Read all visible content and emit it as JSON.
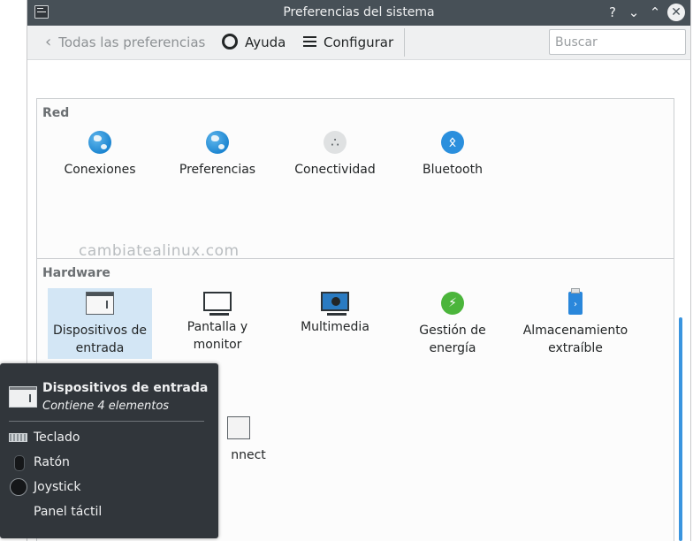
{
  "window": {
    "title": "Preferencias del sistema",
    "titlebar_buttons": {
      "help": "?",
      "minimize": "⌄",
      "maximize": "⌃",
      "close": "✕"
    }
  },
  "toolbar": {
    "back_chevron": "‹",
    "back_label": "Todas las preferencias",
    "help_label": "Ayuda",
    "configure_label": "Configurar",
    "search_placeholder": "Buscar"
  },
  "groups": {
    "red": {
      "title": "Red",
      "items": [
        {
          "label": "Conexiones",
          "icon": "globe-icon"
        },
        {
          "label": "Preferencias",
          "icon": "globe-icon"
        },
        {
          "label": "Conectividad",
          "icon": "share-icon"
        },
        {
          "label": "Bluetooth",
          "icon": "bluetooth-icon"
        }
      ]
    },
    "hardware": {
      "title": "Hardware",
      "items": [
        {
          "label": "Dispositivos de entrada",
          "icon": "input-devices-icon",
          "selected": true
        },
        {
          "label": "Pantalla y monitor",
          "icon": "monitor-icon"
        },
        {
          "label": "Multimedia",
          "icon": "multimedia-icon"
        },
        {
          "label": "Gestión de energía",
          "icon": "energy-icon"
        },
        {
          "label": "Almacenamiento extraíble",
          "icon": "usb-storage-icon"
        },
        {
          "label": "nnect",
          "icon": "kdeconnect-icon",
          "partially_hidden": true
        }
      ]
    }
  },
  "watermark": "cambiatealinux.com",
  "popup": {
    "title": "Dispositivos de entrada",
    "subtitle": "Contiene 4 elementos",
    "items": [
      {
        "label": "Teclado",
        "icon": "keyboard-icon"
      },
      {
        "label": "Ratón",
        "icon": "mouse-icon"
      },
      {
        "label": "Joystick",
        "icon": "joystick-icon"
      },
      {
        "label": "Panel táctil",
        "icon": ""
      }
    ]
  },
  "colors": {
    "titlebar": "#475057",
    "selection": "#d3e6f5",
    "accent": "#3a95df",
    "popup_bg": "#31363b"
  }
}
